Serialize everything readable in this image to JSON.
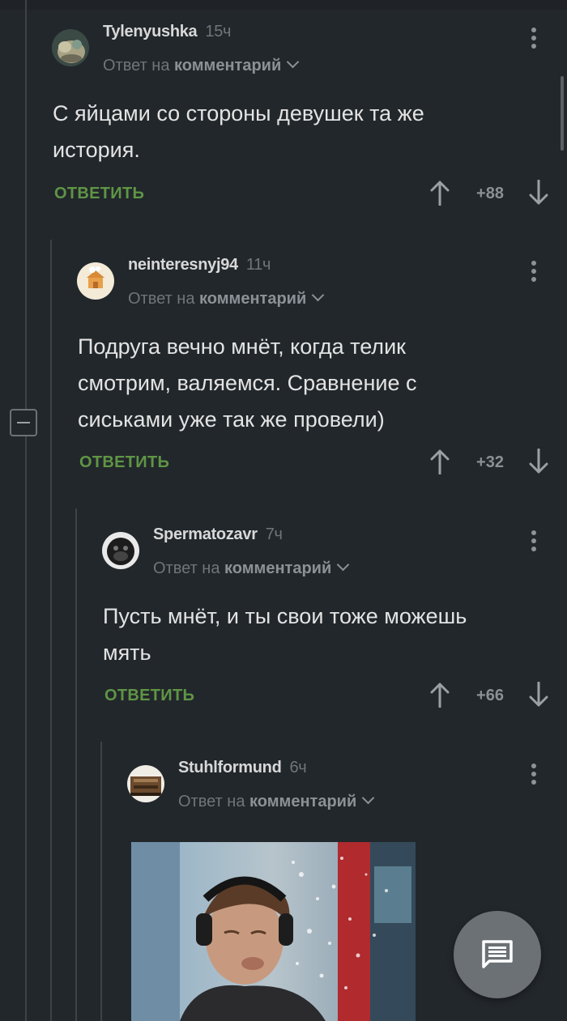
{
  "comments": [
    {
      "username": "Tylenyushka",
      "time": "15ч",
      "reply_prefix": "Ответ на",
      "reply_target": "комментарий",
      "text_lines": [
        "С яйцами со стороны девушек та же",
        "история."
      ],
      "reply_label": "ОТВЕТИТЬ",
      "score": "+88"
    },
    {
      "username": "neinteresnyj94",
      "time": "11ч",
      "reply_prefix": "Ответ на",
      "reply_target": "комментарий",
      "text_lines": [
        "Подруга вечно мнёт, когда телик",
        "смотрим, валяемся. Сравнение с",
        "сиськами уже так же провели)"
      ],
      "reply_label": "ОТВЕТИТЬ",
      "score": "+32"
    },
    {
      "username": "Spermatozavr",
      "time": "7ч",
      "reply_prefix": "Ответ на",
      "reply_target": "комментарий",
      "text_lines": [
        "Пусть мнёт, и ты свои тоже можешь",
        "мять"
      ],
      "reply_label": "ОТВЕТИТЬ",
      "score": "+66"
    },
    {
      "username": "Stuhlformund",
      "time": "6ч",
      "reply_prefix": "Ответ на",
      "reply_target": "комментарий"
    }
  ],
  "icons": {
    "collapse": "minus-square-icon",
    "more": "more-vertical-icon",
    "upvote": "arrow-up-icon",
    "downvote": "arrow-down-icon",
    "fab": "comment-icon",
    "expand": "chevron-down-icon"
  },
  "colors": {
    "background": "#22272b",
    "reply_green": "#5f9545",
    "muted": "#6f757b",
    "text": "#e3e3e3"
  }
}
